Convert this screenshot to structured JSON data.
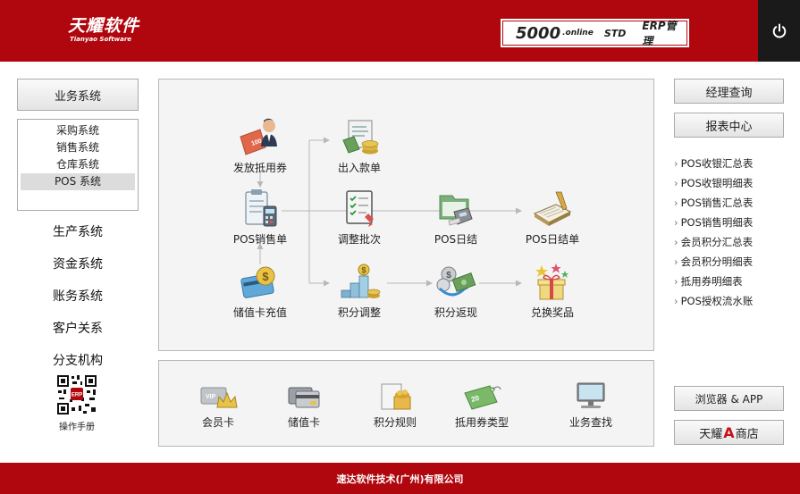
{
  "header": {
    "logo_main": "天耀软件",
    "logo_sub": "Tianyao Software",
    "product_number": "5000",
    "product_online": ".online",
    "product_edition": "STD",
    "product_name": "ERP管理"
  },
  "left": {
    "business_button": "业务系统",
    "submenu": [
      {
        "label": "采购系统"
      },
      {
        "label": "销售系统"
      },
      {
        "label": "仓库系统"
      },
      {
        "label": "POS 系统",
        "active": true
      }
    ],
    "links": [
      "生产系统",
      "资金系统",
      "账务系统",
      "客户关系",
      "分支机构"
    ],
    "manual_label": "操作手册"
  },
  "flow": {
    "nodes": {
      "issue_coupon": "发放抵用券",
      "cash_in_out": "出入款单",
      "pos_sales": "POS销售单",
      "adjust_batch": "调整批次",
      "pos_daily": "POS日结",
      "pos_daily_statement": "POS日结单",
      "card_recharge": "储值卡充值",
      "points_adjust": "积分调整",
      "points_return": "积分返现",
      "redeem_prize": "兑换奖品"
    }
  },
  "bottom": {
    "items": [
      "会员卡",
      "储值卡",
      "积分规则",
      "抵用券类型",
      "业务查找"
    ]
  },
  "right": {
    "manager_query": "经理查询",
    "report_center": "报表中心",
    "reports": [
      "POS收银汇总表",
      "POS收银明细表",
      "POS销售汇总表",
      "POS销售明细表",
      "会员积分汇总表",
      "会员积分明细表",
      "抵用券明细表",
      "POS授权流水账"
    ],
    "browser_app": "浏览器 & APP",
    "store_prefix": "天耀",
    "store_letter": "A",
    "store_suffix": "商店"
  },
  "footer": {
    "company": "速达软件技术(广州)有限公司"
  },
  "colors": {
    "brand_red": "#b0070f",
    "power_bg": "#1a1a1a",
    "panel_bg": "#f4f4f4"
  }
}
